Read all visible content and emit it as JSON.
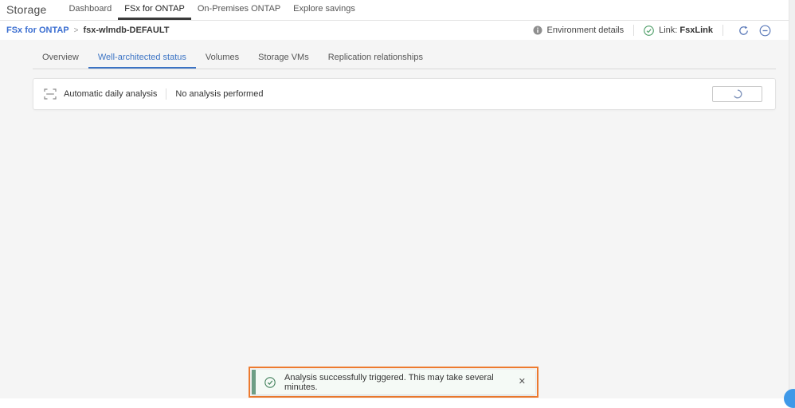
{
  "app_title": "Storage",
  "top_tabs": {
    "dashboard": "Dashboard",
    "fsx_for_ontap": "FSx for ONTAP",
    "on_premises_ontap": "On-Premises ONTAP",
    "explore_savings": "Explore savings"
  },
  "breadcrumb": {
    "parent": "FSx for ONTAP",
    "separator": ">",
    "current": "fsx-wlmdb-DEFAULT"
  },
  "toolbar": {
    "environment_details": "Environment details",
    "link_label": "Link:",
    "link_value": "FsxLink"
  },
  "content_tabs": {
    "overview": "Overview",
    "well_architected": "Well-architected status",
    "volumes": "Volumes",
    "storage_vms": "Storage VMs",
    "replication": "Replication relationships"
  },
  "analysis_card": {
    "title": "Automatic daily analysis",
    "status": "No analysis performed"
  },
  "toast": {
    "message": "Analysis successfully triggered. This may take several minutes.",
    "close_glyph": "✕"
  },
  "icons": {
    "info": "info-circle",
    "link_status": "check-circle",
    "refresh": "circular-arrow",
    "collapse": "minus-circle",
    "analysis": "scan-frame",
    "button_state": "loading-spinner",
    "toast_status": "check-circle"
  },
  "colors": {
    "accent_blue": "#3b73c4",
    "link_blue": "#3c6fd1",
    "active_top_tab_underline": "#3a3a3a",
    "toolbar_icon_blue": "#5e7cba",
    "success_green": "#41805b",
    "toast_bar_green": "#6d9e85",
    "toast_bg": "#f5faf6",
    "highlight_orange": "#ee7b2f",
    "fab_blue": "#3f99e8",
    "main_bg": "#f5f5f5"
  }
}
